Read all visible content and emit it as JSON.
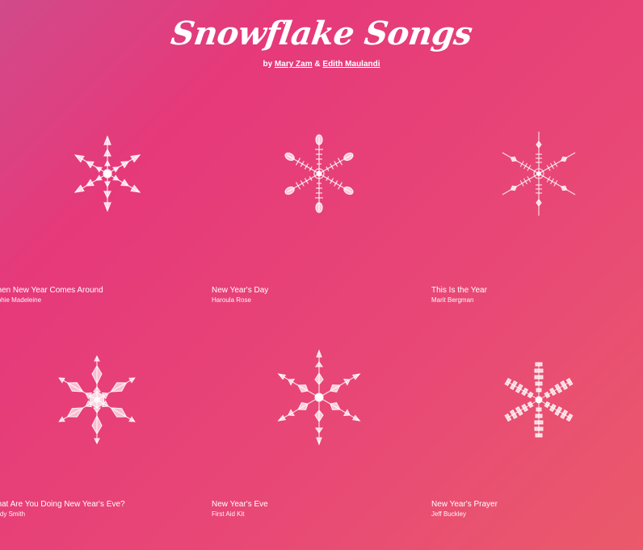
{
  "header": {
    "title": "Snowflake Songs",
    "by_prefix": "by",
    "author1": "Mary Zam",
    "amp": "&",
    "author2": "Edith Maulandi"
  },
  "songs": [
    {
      "title": "When New Year Comes Around",
      "artist": "Sophie Madeleine",
      "icon": "snowflake-icon"
    },
    {
      "title": "New Year's Day",
      "artist": "Haroula Rose",
      "icon": "snowflake-icon"
    },
    {
      "title": "This Is the Year",
      "artist": "Marit Bergman",
      "icon": "snowflake-icon"
    },
    {
      "title": "What Are You Doing New Year's Eve?",
      "artist": "Mindy Smith",
      "icon": "snowflake-icon"
    },
    {
      "title": "New Year's Eve",
      "artist": "First Aid Kit",
      "icon": "snowflake-icon"
    },
    {
      "title": "New Year's Prayer",
      "artist": "Jeff Buckley",
      "icon": "snowflake-icon"
    }
  ],
  "colors": {
    "background_start": "#d14a8a",
    "background_end": "#ea5a6a",
    "snowflake": "#ffffff"
  }
}
